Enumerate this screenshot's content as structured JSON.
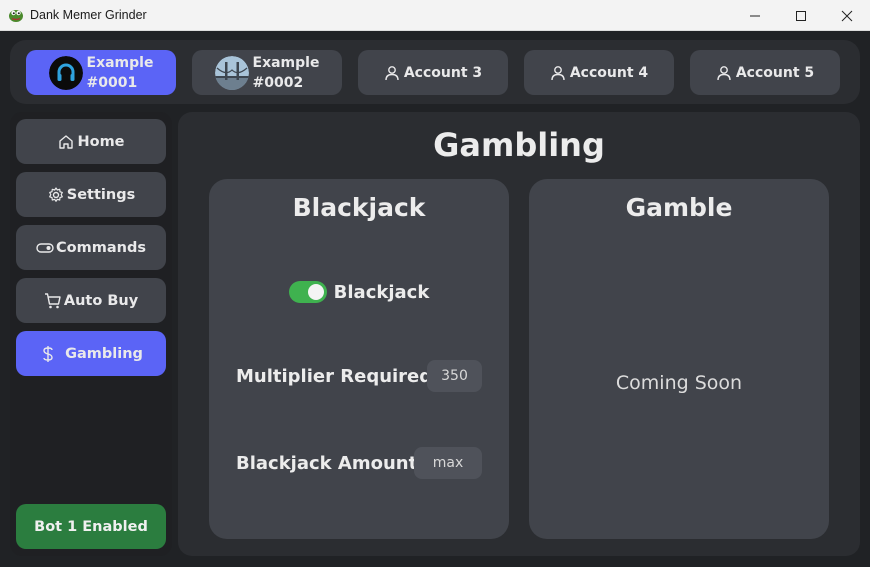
{
  "window": {
    "title": "Dank Memer Grinder",
    "controls": [
      "minimize-icon",
      "maximize-icon",
      "close-icon"
    ]
  },
  "accounts": [
    {
      "line1": "Example",
      "line2": "#0001",
      "active": true,
      "avatar": "headphones-avatar"
    },
    {
      "line1": "Example",
      "line2": "#0002",
      "active": false,
      "avatar": "bridge-avatar"
    },
    {
      "label": "Account 3",
      "icon": "user-icon"
    },
    {
      "label": "Account 4",
      "icon": "user-icon"
    },
    {
      "label": "Account 5",
      "icon": "user-icon"
    }
  ],
  "sidebar": {
    "items": [
      {
        "label": "Home",
        "icon": "home-icon"
      },
      {
        "label": "Settings",
        "icon": "gear-icon"
      },
      {
        "label": "Commands",
        "icon": "toggle-icon"
      },
      {
        "label": "Auto Buy",
        "icon": "cart-icon"
      },
      {
        "label": "Gambling",
        "icon": "dollar-icon",
        "active": true
      }
    ],
    "bot_status": "Bot 1 Enabled"
  },
  "main": {
    "title": "Gambling",
    "blackjack": {
      "title": "Blackjack",
      "toggle_label": "Blackjack",
      "toggle_on": true,
      "multiplier_label": "Multiplier Required",
      "multiplier_value": "350",
      "amount_label": "Blackjack Amount",
      "amount_value": "max"
    },
    "gamble": {
      "title": "Gamble",
      "message": "Coming Soon"
    }
  },
  "colors": {
    "accent": "#5b64f6",
    "enabled": "#2b7d3f",
    "toggle_on": "#3fb24f",
    "panel": "#41444b",
    "background": "#202225"
  }
}
